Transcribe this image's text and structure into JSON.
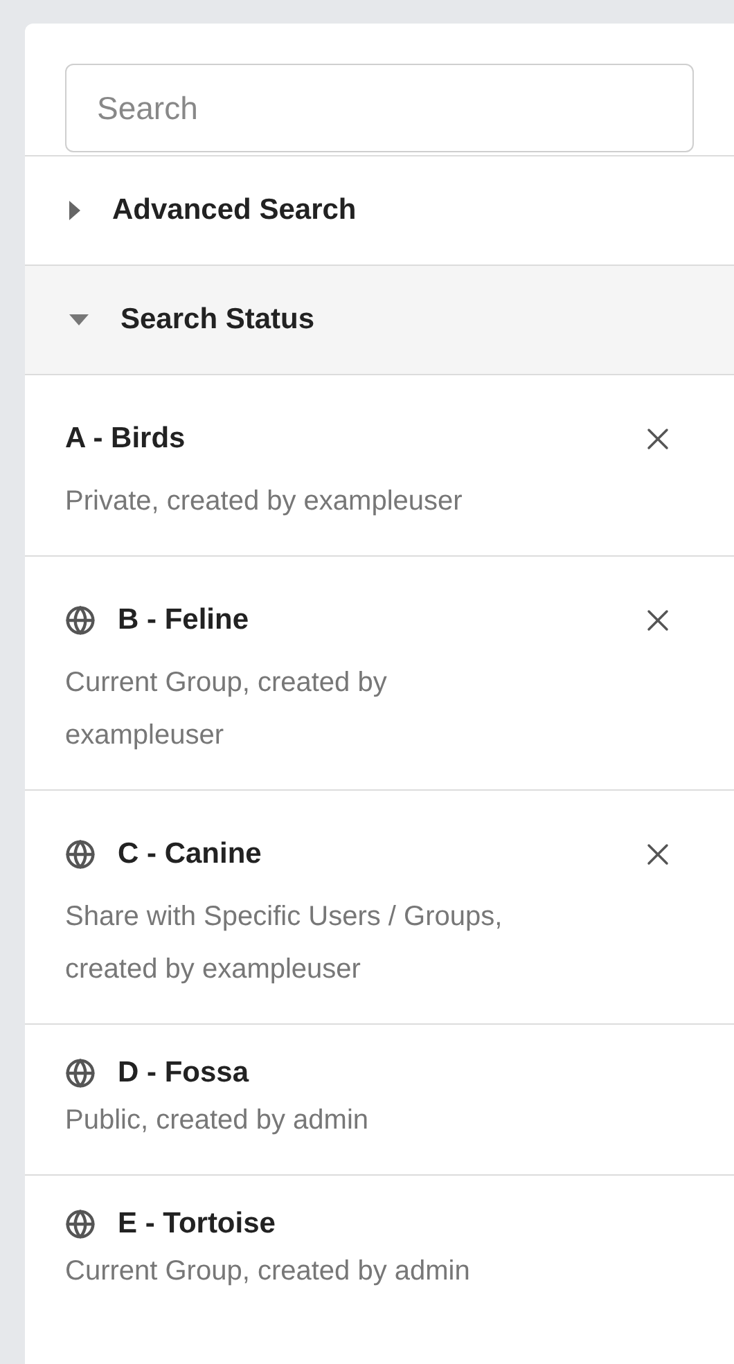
{
  "search": {
    "placeholder": "Search"
  },
  "sections": [
    {
      "label": "Advanced Search",
      "expanded": false
    },
    {
      "label": "Search Status",
      "expanded": true
    }
  ],
  "saved_searches": [
    {
      "name": "A - Birds",
      "description": "Private, created by exampleuser",
      "shared": false,
      "removable": true
    },
    {
      "name": "B - Feline",
      "description": "Current Group, created by exampleuser",
      "shared": true,
      "removable": true
    },
    {
      "name": "C - Canine",
      "description": "Share with Specific Users / Groups, created by exampleuser",
      "shared": true,
      "removable": true
    },
    {
      "name": "D - Fossa",
      "description": "Public, created by admin",
      "shared": true,
      "removable": false
    },
    {
      "name": "E - Tortoise",
      "description": "Current Group, created by admin",
      "shared": true,
      "removable": false
    }
  ]
}
